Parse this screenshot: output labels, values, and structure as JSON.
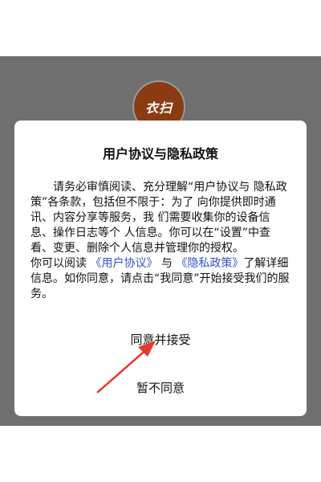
{
  "app": {
    "logo_text": "衣扫"
  },
  "dialog": {
    "title": "用户协议与隐私政策",
    "paragraph1": "请务必审慎阅读、充分理解“用户协议与 隐私政策”各条款，包括但不限于：为了 向你提供即时通讯、内容分享等服务，我 们需要收集你的设备信息、操作日志等个 人信息。你可以在“设置”中查看、变更、删除个人信息并管理你的授权。",
    "paragraph2_prefix": "你可以阅读",
    "user_agreement_link": "《用户协议》",
    "paragraph2_and": "与",
    "privacy_policy_link": "《隐私政策》",
    "paragraph2_suffix": "了解详细信息。如你同意，请点击“我同意”开始接受我们的服务。",
    "agree_label": "同意并接受",
    "disagree_label": "暂不同意"
  },
  "colors": {
    "overlay": "#6f6f6f",
    "logo_bg": "#8a3b12",
    "link": "#2f55d4",
    "arrow": "#e8382b"
  }
}
